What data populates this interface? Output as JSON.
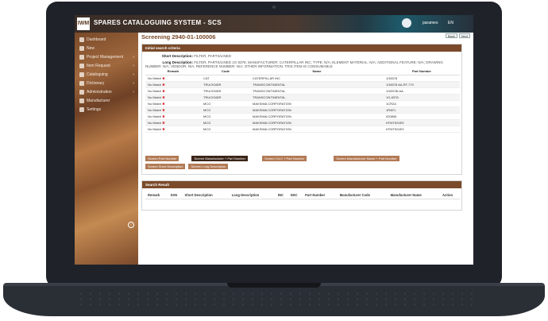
{
  "app": {
    "logo_text": "IWM",
    "title": "SPARES CATALOGUING SYSTEM - SCS",
    "username": "parames",
    "language": "EN"
  },
  "sidebar": {
    "items": [
      {
        "label": "Dashboard",
        "icon": "dashboard-icon",
        "has_children": false
      },
      {
        "label": "New",
        "icon": "plus-icon",
        "has_children": false
      },
      {
        "label": "Project Management",
        "icon": "briefcase-icon",
        "has_children": true
      },
      {
        "label": "Item Request",
        "icon": "list-icon",
        "has_children": true
      },
      {
        "label": "Cataloguing",
        "icon": "book-icon",
        "has_children": true
      },
      {
        "label": "Dictionary",
        "icon": "dictionary-icon",
        "has_children": true
      },
      {
        "label": "Administration",
        "icon": "gear-icon",
        "has_children": true
      },
      {
        "label": "Manufacturer",
        "icon": "factory-icon",
        "has_children": false
      },
      {
        "label": "Settings",
        "icon": "settings-icon",
        "has_children": false
      }
    ],
    "collapse_icon": "collapse-arrow-icon"
  },
  "main": {
    "page_title": "Screening 2940-01-100006",
    "top_buttons": [
      "Back",
      "Next"
    ],
    "criteria_panel": {
      "title": "Initial search criteria",
      "short_desc_label": "Short Description:",
      "short_desc_value": "FILTER, PARTS/LINED",
      "long_desc_label": "Long Description:",
      "long_desc_value": "FILTER, PARTS/LINED 1G 8378, MANUFACTURER: CATERPILLAR INC; TYPE: N/A; ELEMENT MATERIAL: N/A; ADDITIONAL FEATURE: N/A; DRAWING NUMBER: N/A; VENDOR: N/A; REFERENCE NUMBER: N/A; OTHER INFORMATION: TRIS ITEM IS CONSUMABLE",
      "table": {
        "headers": [
          "Remark",
          "Code",
          "Name",
          "Part Number"
        ],
        "rows": [
          {
            "remark": "No Match",
            "code": "CAT",
            "name": "CATERPILLAR INC",
            "part": "1G8378"
          },
          {
            "remark": "No Match",
            "code": "TRUCKNDR",
            "name": "TRANSCONTINENTAL",
            "part": "1G8378 AA-RT-770"
          },
          {
            "remark": "No Match",
            "code": "TRUCKNDR",
            "name": "TRANSCONTINENTAL",
            "part": "1G8378LAA"
          },
          {
            "remark": "No Match",
            "code": "TRUCKNDR",
            "name": "TRANSCONTINENTAL",
            "part": "1G-8378"
          },
          {
            "remark": "No Match",
            "code": "MCG",
            "name": "MAKSIMA CORPORATION",
            "part": "1CR2A"
          },
          {
            "remark": "No Match",
            "code": "MCG",
            "name": "MAKSIMA CORPORATION",
            "part": "1R4E1"
          },
          {
            "remark": "No Match",
            "code": "MCG",
            "name": "MAKSIMA CORPORATION",
            "part": "020806"
          },
          {
            "remark": "No Match",
            "code": "MCG",
            "name": "MAKSIMA CORPORATION",
            "part": "KFI6T524E9"
          },
          {
            "remark": "No Match",
            "code": "MCG",
            "name": "MAKSIMA CORPORATION",
            "part": "KFI6T524E3"
          }
        ]
      },
      "buttons_row1": [
        "Screen Part Number",
        "Screen Manufacturer + Part Number",
        "Screen I.N.C + Part Number",
        "Screen Manufacturer Name + Part Number"
      ],
      "buttons_row2": [
        "Screen Short Description",
        "Screen Long Description"
      ]
    },
    "result_panel": {
      "title": "Search Result",
      "headers": [
        "Remark",
        "SSN",
        "Short Description",
        "Long Description",
        "INC",
        "NSC",
        "Part Number",
        "Manufacturer Code",
        "Manufacturer Name",
        "Action"
      ]
    }
  }
}
